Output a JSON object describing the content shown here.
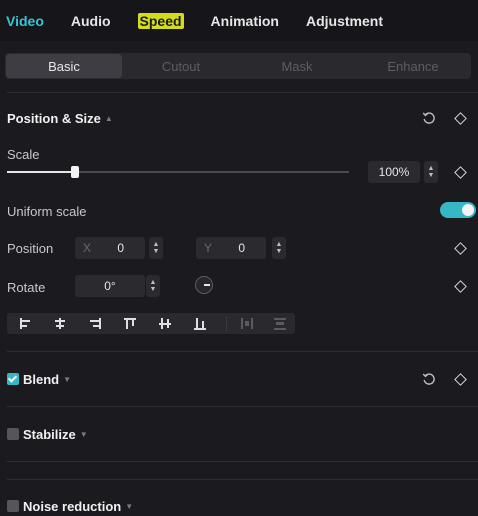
{
  "tabs": [
    {
      "label": "Video",
      "state": "active"
    },
    {
      "label": "Audio",
      "state": ""
    },
    {
      "label": "Speed",
      "state": "highlighted"
    },
    {
      "label": "Animation",
      "state": ""
    },
    {
      "label": "Adjustment",
      "state": ""
    }
  ],
  "subtabs": [
    {
      "label": "Basic",
      "active": true
    },
    {
      "label": "Cutout",
      "active": false
    },
    {
      "label": "Mask",
      "active": false
    },
    {
      "label": "Enhance",
      "active": false
    }
  ],
  "position_size": {
    "title": "Position & Size",
    "scale": {
      "label": "Scale",
      "value": "100%",
      "slider_fraction": 0.2
    },
    "uniform_scale": {
      "label": "Uniform scale",
      "enabled": true
    },
    "position": {
      "label": "Position",
      "x_label": "X",
      "x_value": "0",
      "y_label": "Y",
      "y_value": "0"
    },
    "rotate": {
      "label": "Rotate",
      "value": "0°"
    }
  },
  "blend": {
    "title": "Blend",
    "checked": true
  },
  "stabilize": {
    "title": "Stabilize",
    "checked": false
  },
  "noise_reduction": {
    "title": "Noise reduction",
    "checked": false
  },
  "colors": {
    "accent": "#37c4d6",
    "toggle": "#37b6c6",
    "highlight": "#d5dc1c",
    "background": "#1b1b1f"
  }
}
